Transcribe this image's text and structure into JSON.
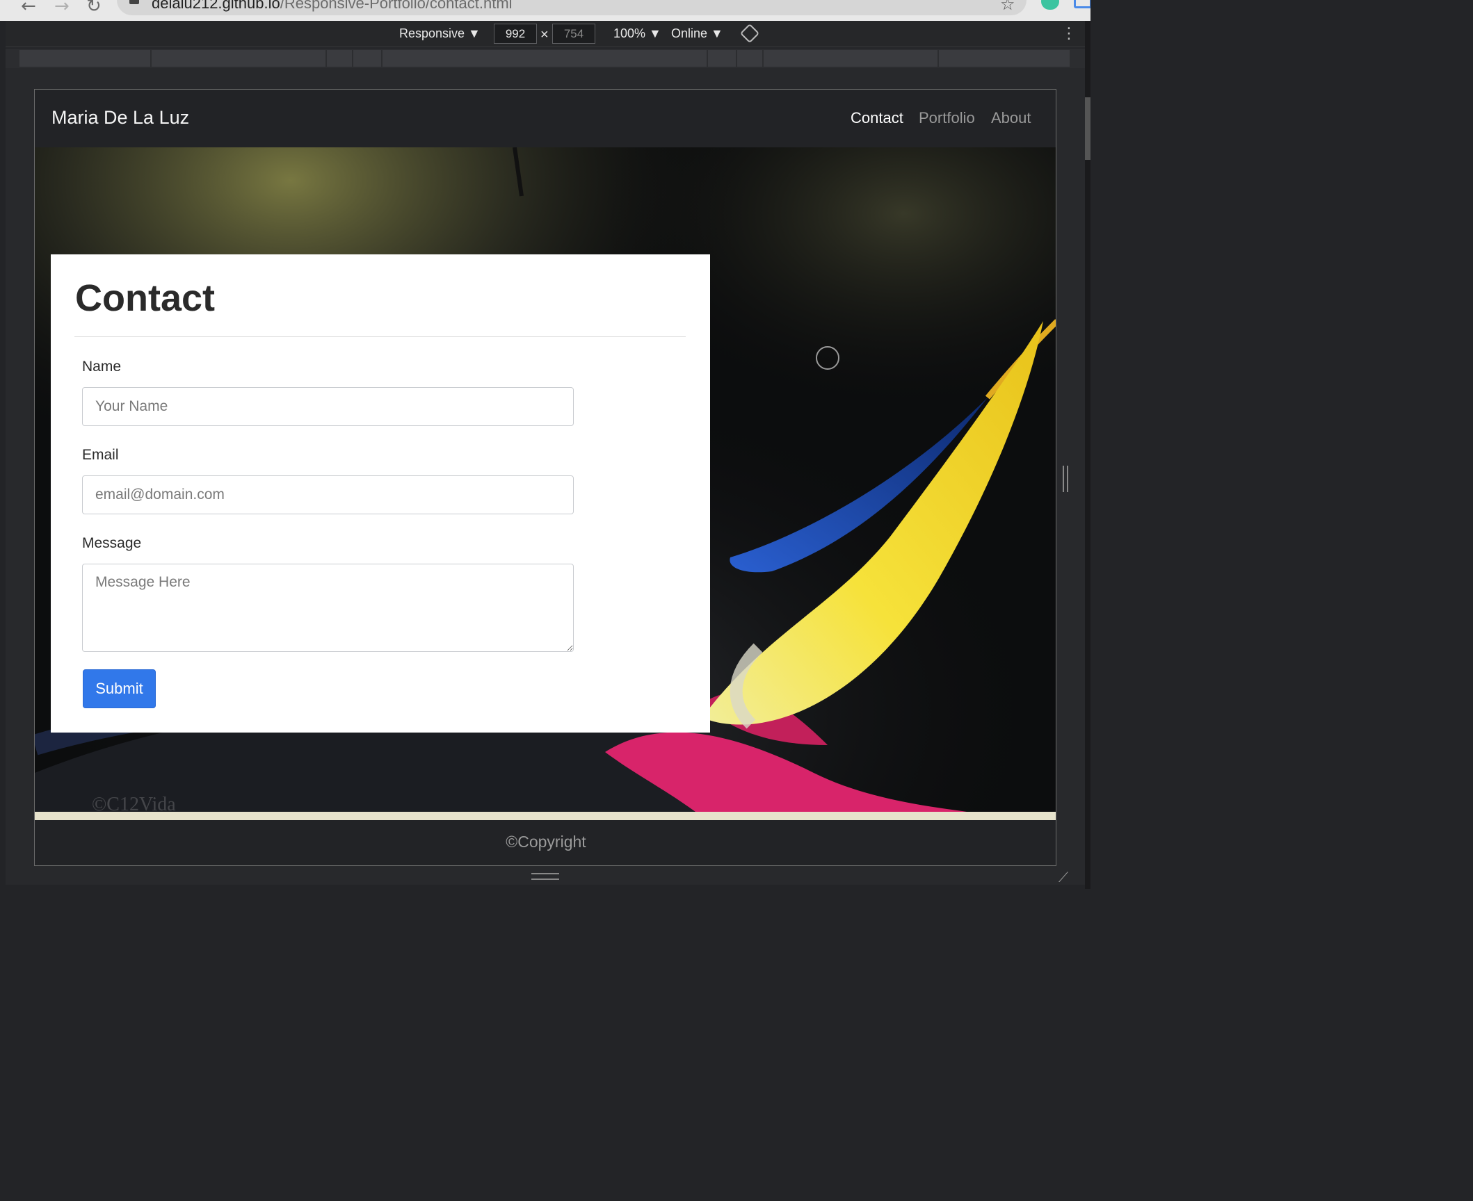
{
  "browser": {
    "url_host": "delalu212.github.io",
    "url_path": "/Responsive-Portfolio/contact.html",
    "back_icon": "←",
    "forward_icon": "→",
    "reload_icon": "↻",
    "star_icon": "☆"
  },
  "devtools": {
    "device_mode": "Responsive ▼",
    "width": "992",
    "height": "754",
    "zoom": "100% ▼",
    "throttling": "Online ▼",
    "kebab_icon": "⋮"
  },
  "site": {
    "brand": "Maria De La Luz",
    "nav": {
      "contact": "Contact",
      "portfolio": "Portfolio",
      "about": "About"
    },
    "hero": {
      "watermark": "©C12Vida"
    },
    "form": {
      "title": "Contact",
      "name_label": "Name",
      "name_placeholder": "Your Name",
      "email_label": "Email",
      "email_placeholder": "email@domain.com",
      "message_label": "Message",
      "message_placeholder": "Message Here",
      "submit_label": "Submit"
    },
    "footer": "©Copyright"
  },
  "colors": {
    "navbar_bg": "#222326",
    "submit_blue": "#3178ea",
    "cream_strip": "#e7e3cc"
  }
}
